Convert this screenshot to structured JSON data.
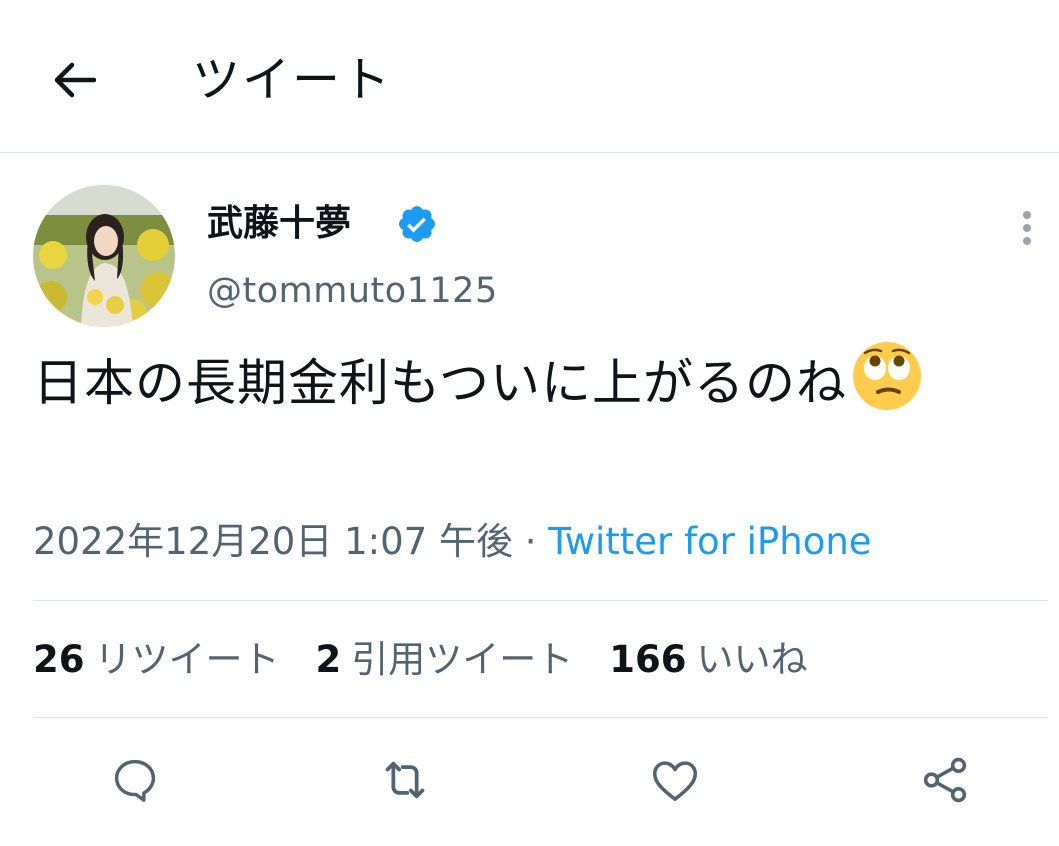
{
  "header": {
    "title": "ツイート"
  },
  "author": {
    "name": "武藤十夢",
    "handle": "@tommuto1125",
    "verified": true
  },
  "tweet": {
    "text": "日本の長期金利もついに上がるのね",
    "emoji": "face-with-rolling-eyes"
  },
  "meta": {
    "date": "2022年12月20日",
    "time": "1:07 午後",
    "separator": " · ",
    "source": "Twitter for iPhone"
  },
  "stats": {
    "retweets": {
      "count": "26",
      "label": "リツイート"
    },
    "quotes": {
      "count": "2",
      "label": "引用ツイート"
    },
    "likes": {
      "count": "166",
      "label": "いいね"
    }
  },
  "actions": [
    "reply-icon",
    "retweet-icon",
    "like-icon",
    "share-icon"
  ],
  "colors": {
    "accent": "#1d9bf0",
    "text": "#0f1419",
    "secondary": "#536471",
    "divider": "#dde3e8"
  }
}
